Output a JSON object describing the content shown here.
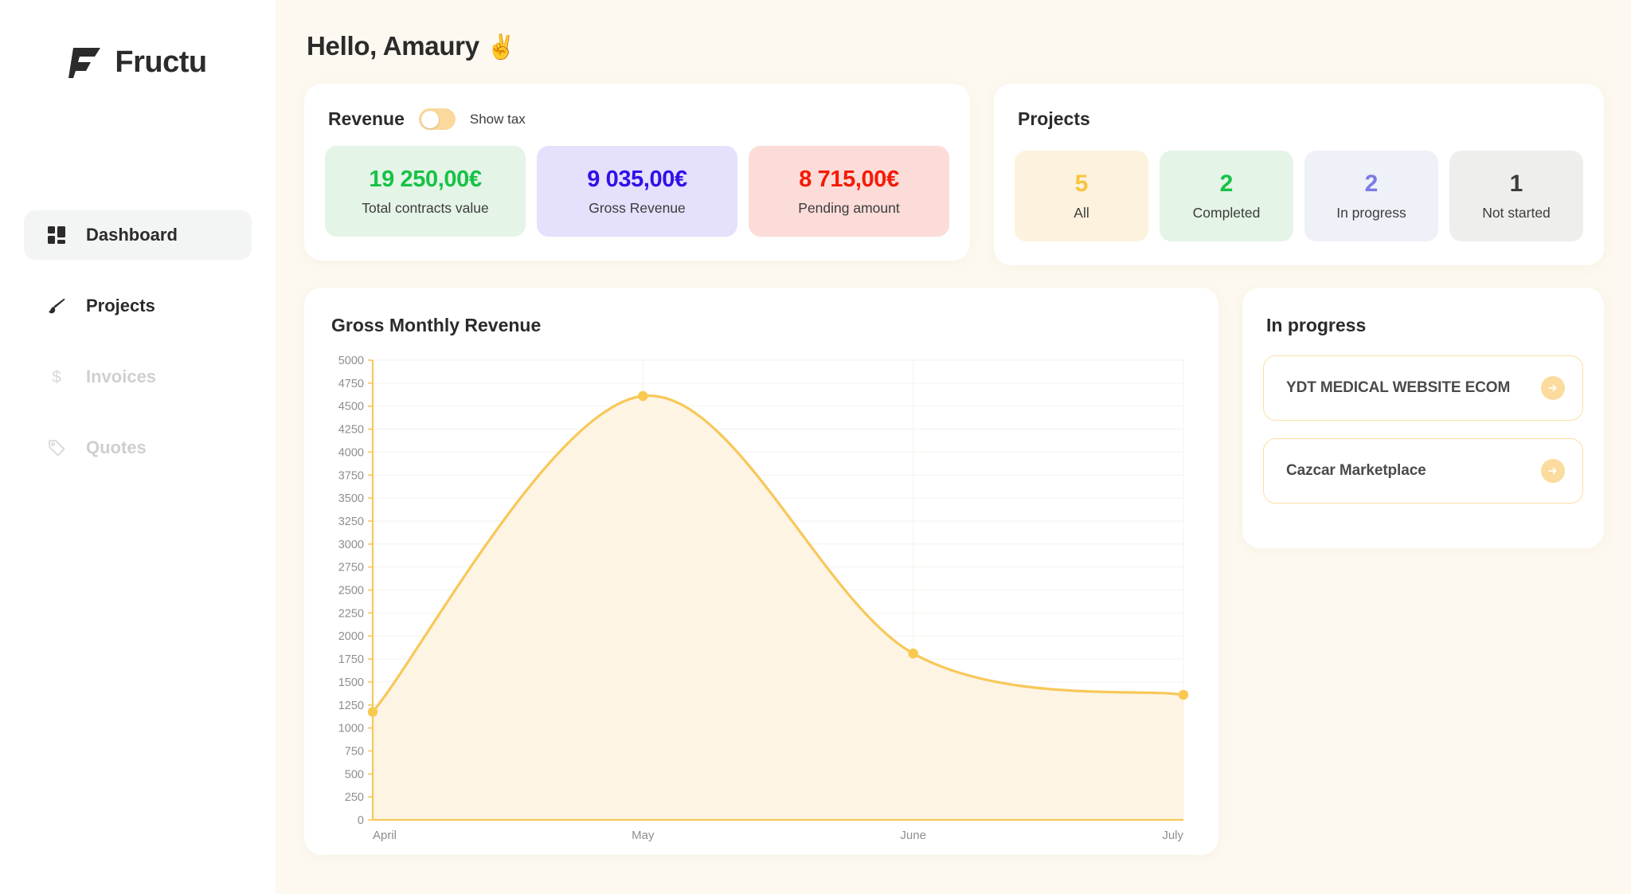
{
  "brand": {
    "name": "Fructu",
    "logo_icon": "fructu-f-logo-icon"
  },
  "sidebar": {
    "items": [
      {
        "label": "Dashboard",
        "icon": "grid-dashboard-icon",
        "active": true
      },
      {
        "label": "Projects",
        "icon": "paintbrush-icon",
        "active": false
      },
      {
        "label": "Invoices",
        "icon": "dollar-sign-icon",
        "active": false
      },
      {
        "label": "Quotes",
        "icon": "tag-icon",
        "active": false
      }
    ]
  },
  "header": {
    "greeting": "Hello, Amaury",
    "emoji": "✌️"
  },
  "revenue": {
    "title": "Revenue",
    "toggle_label": "Show tax",
    "toggle_on": false,
    "stats": [
      {
        "value": "19 250,00€",
        "label": "Total contracts value",
        "bg": "#e4f4e7",
        "color": "#17c246"
      },
      {
        "value": "9 035,00€",
        "label": "Gross Revenue",
        "bg": "#e5e0fb",
        "color": "#2f10ea"
      },
      {
        "value": "8 715,00€",
        "label": "Pending amount",
        "bg": "#fbdcd8",
        "color": "#f51a06"
      }
    ]
  },
  "projects": {
    "title": "Projects",
    "stats": [
      {
        "value": "5",
        "label": "All",
        "bg": "#fdf2dd",
        "color": "#f8c440"
      },
      {
        "value": "2",
        "label": "Completed",
        "bg": "#e4f4e7",
        "color": "#17c246"
      },
      {
        "value": "2",
        "label": "In progress",
        "bg": "#eef1f7",
        "color": "#7b7ae4"
      },
      {
        "value": "1",
        "label": "Not started",
        "bg": "#eeeeec",
        "color": "#3c3c3c"
      }
    ]
  },
  "in_progress": {
    "title": "In progress",
    "items": [
      {
        "name": "YDT MEDICAL WEBSITE ECOM",
        "arrow_icon": "arrow-right-icon"
      },
      {
        "name": "Cazcar Marketplace",
        "arrow_icon": "arrow-right-icon"
      }
    ]
  },
  "chart_data": {
    "type": "area",
    "title": "Gross Monthly Revenue",
    "xlabel": "",
    "ylabel": "",
    "categories": [
      "April",
      "May",
      "June",
      "July"
    ],
    "x_tick_labels": [
      "April",
      "May",
      "June",
      "July"
    ],
    "values": [
      1175,
      4610,
      1810,
      1360
    ],
    "series": [
      {
        "name": "Gross Monthly Revenue",
        "values": [
          1175,
          4610,
          1810,
          1360
        ]
      }
    ],
    "ylim": [
      0,
      5000
    ],
    "y_tick_step": 250,
    "y_tick_labels": [
      "0",
      "250",
      "500",
      "750",
      "1000",
      "1250",
      "1500",
      "1750",
      "2000",
      "2250",
      "2500",
      "2750",
      "3000",
      "3250",
      "3500",
      "3750",
      "4000",
      "4250",
      "4500",
      "4750",
      "5000"
    ],
    "grid": true,
    "legend": false,
    "curve": "smooth",
    "line_color": "#f7c859",
    "fill_color": "#fdf4e3",
    "point_color": "#f8c94f",
    "axis_color": "#f6c85a"
  }
}
